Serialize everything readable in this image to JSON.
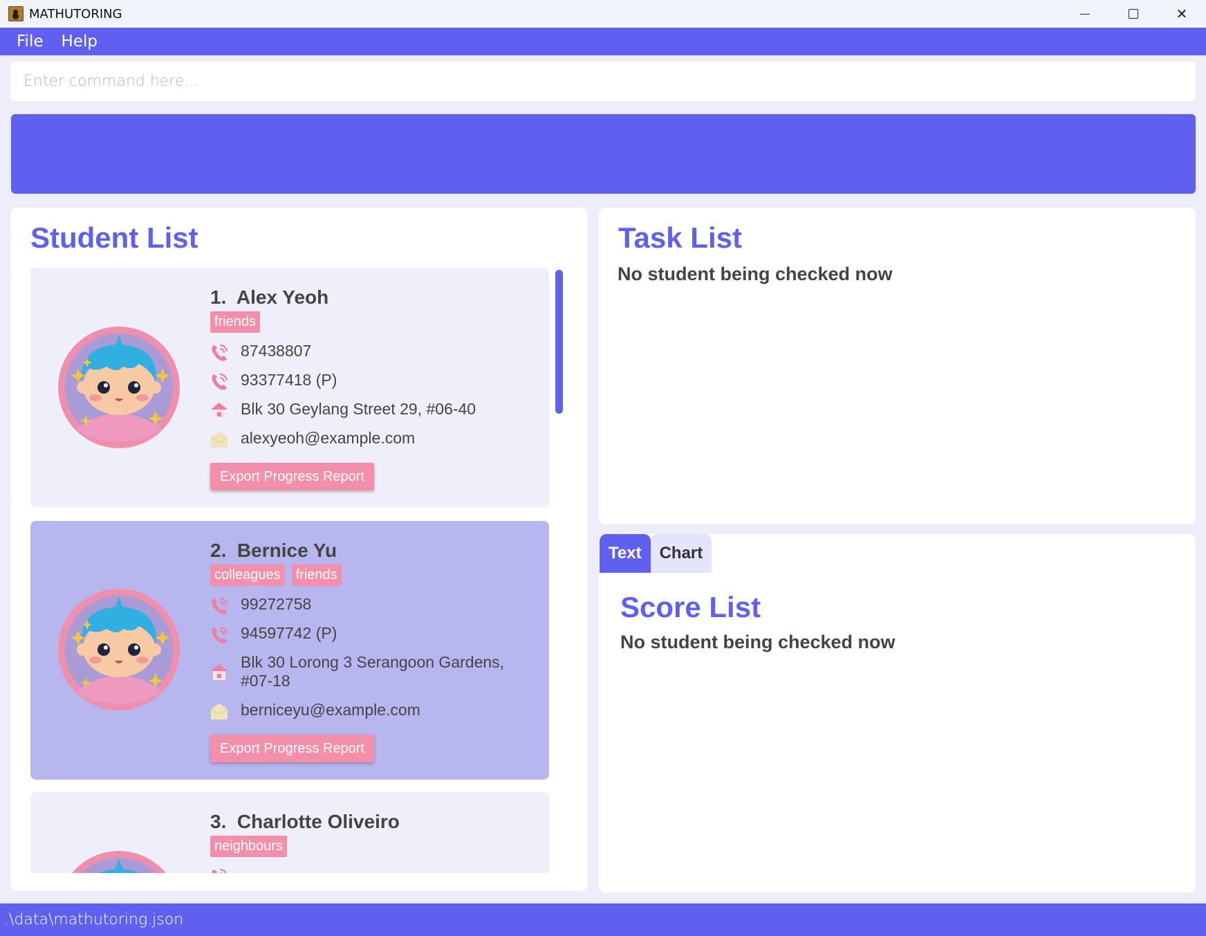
{
  "window": {
    "title": "MATHUTORING"
  },
  "menu": {
    "file": "File",
    "help": "Help"
  },
  "command": {
    "placeholder": "Enter command here..."
  },
  "student_panel": {
    "title": "Student List",
    "students": [
      {
        "index": "1.",
        "name": "Alex Yeoh",
        "tags": [
          "friends"
        ],
        "phone": "87438807",
        "parent_phone": "93377418 (P)",
        "address": "Blk 30 Geylang Street 29, #06-40",
        "email": "alexyeoh@example.com",
        "export_label": "Export Progress Report"
      },
      {
        "index": "2.",
        "name": "Bernice Yu",
        "tags": [
          "colleagues",
          "friends"
        ],
        "phone": "99272758",
        "parent_phone": "94597742 (P)",
        "address_line1": "Blk 30 Lorong 3 Serangoon Gardens,",
        "address_line2": "#07-18",
        "email": "berniceyu@example.com",
        "export_label": "Export Progress Report"
      },
      {
        "index": "3.",
        "name": "Charlotte Oliveiro",
        "tags": [
          "neighbours"
        ]
      }
    ]
  },
  "task_panel": {
    "title": "Task List",
    "message": "No student being checked now"
  },
  "score_panel": {
    "tabs": [
      "Text",
      "Chart"
    ],
    "active_tab": "Text",
    "title": "Score List",
    "message": "No student being checked now"
  },
  "status": {
    "path": ".\\data\\mathutoring.json"
  },
  "colors": {
    "accent": "#6060f0",
    "tag": "#f38faa",
    "selected_card": "#b7b6ef",
    "card": "#efeefb"
  }
}
